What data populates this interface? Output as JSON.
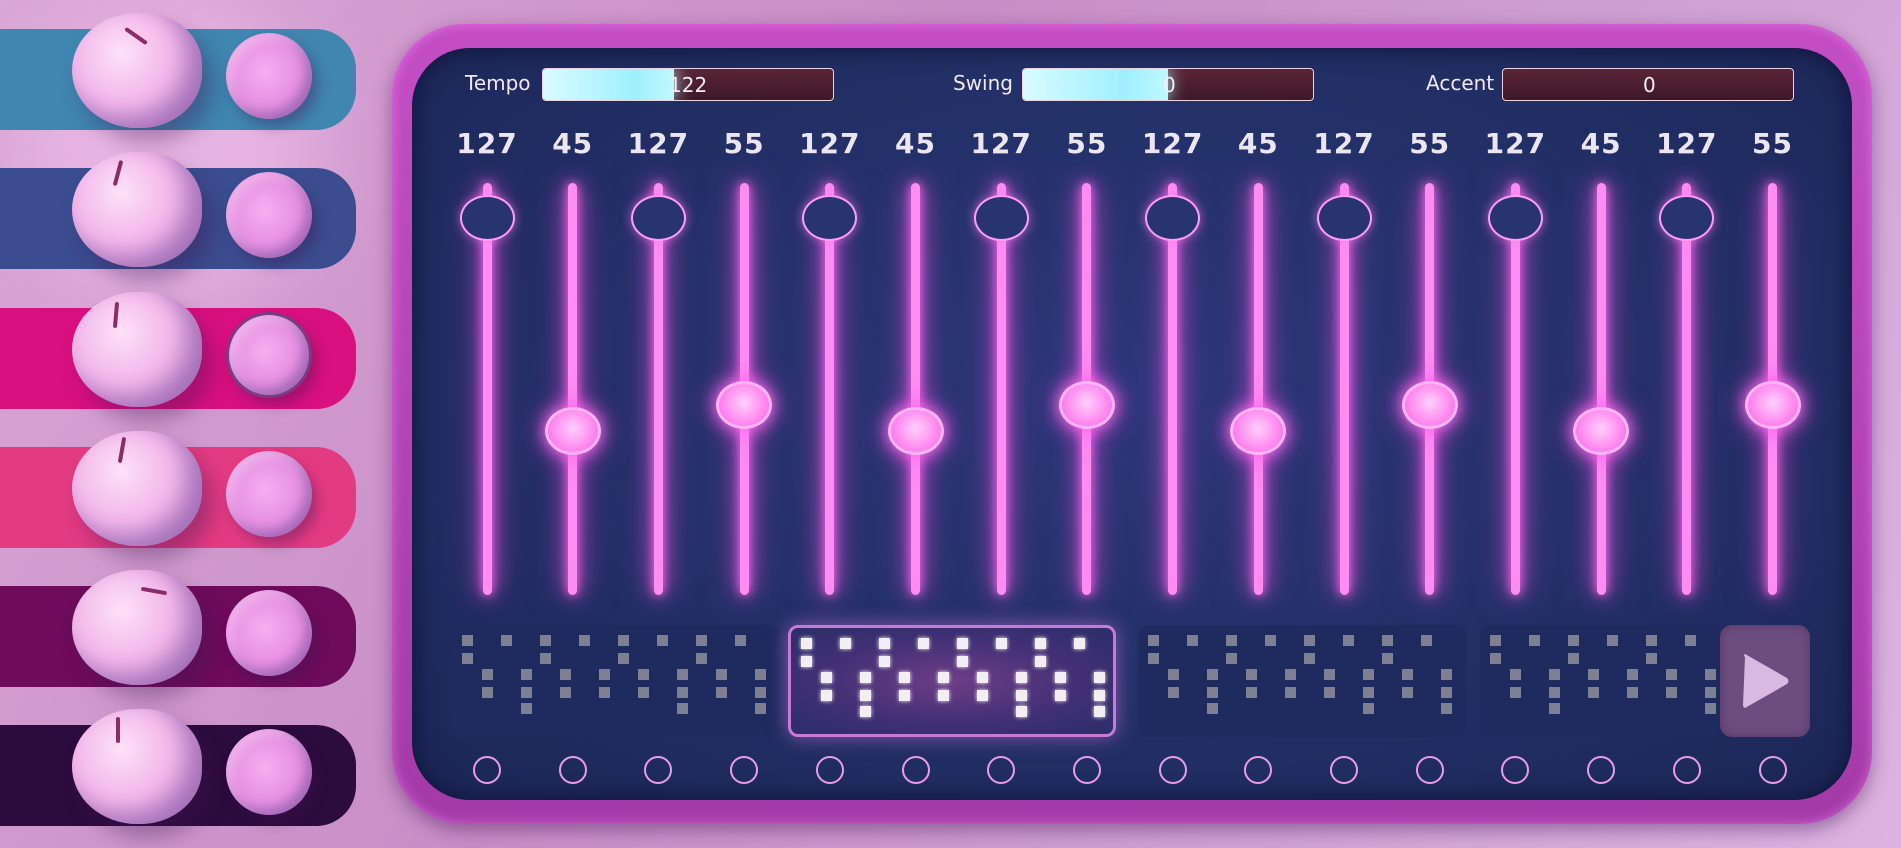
{
  "params": [
    {
      "label": "Tempo",
      "value": "122",
      "fill": 0.45
    },
    {
      "label": "Swing",
      "value": "0",
      "fill": 0.5
    },
    {
      "label": "Accent",
      "value": "0",
      "fill": 0
    }
  ],
  "steps": [
    {
      "value": "127"
    },
    {
      "value": "45"
    },
    {
      "value": "127"
    },
    {
      "value": "55"
    },
    {
      "value": "127"
    },
    {
      "value": "45"
    },
    {
      "value": "127"
    },
    {
      "value": "55"
    },
    {
      "value": "127"
    },
    {
      "value": "45"
    },
    {
      "value": "127"
    },
    {
      "value": "55"
    },
    {
      "value": "127"
    },
    {
      "value": "45"
    },
    {
      "value": "127"
    },
    {
      "value": "55"
    }
  ],
  "channels": [
    {
      "color": "#3f86b0"
    },
    {
      "color": "#3b4d8f"
    },
    {
      "color": "#d9107f"
    },
    {
      "color": "#e33b82"
    },
    {
      "color": "#6e0b5a"
    },
    {
      "color": "#2c0b3e"
    }
  ],
  "patterns": [
    {
      "active": false
    },
    {
      "active": true
    },
    {
      "active": false
    },
    {
      "active": false
    }
  ],
  "play_icon": "play-icon",
  "colors": {
    "panel": "#223066",
    "panel_border": "#b444b6",
    "slider_glow": "#ff8cf3",
    "param_fill": "#9ff0ff"
  }
}
